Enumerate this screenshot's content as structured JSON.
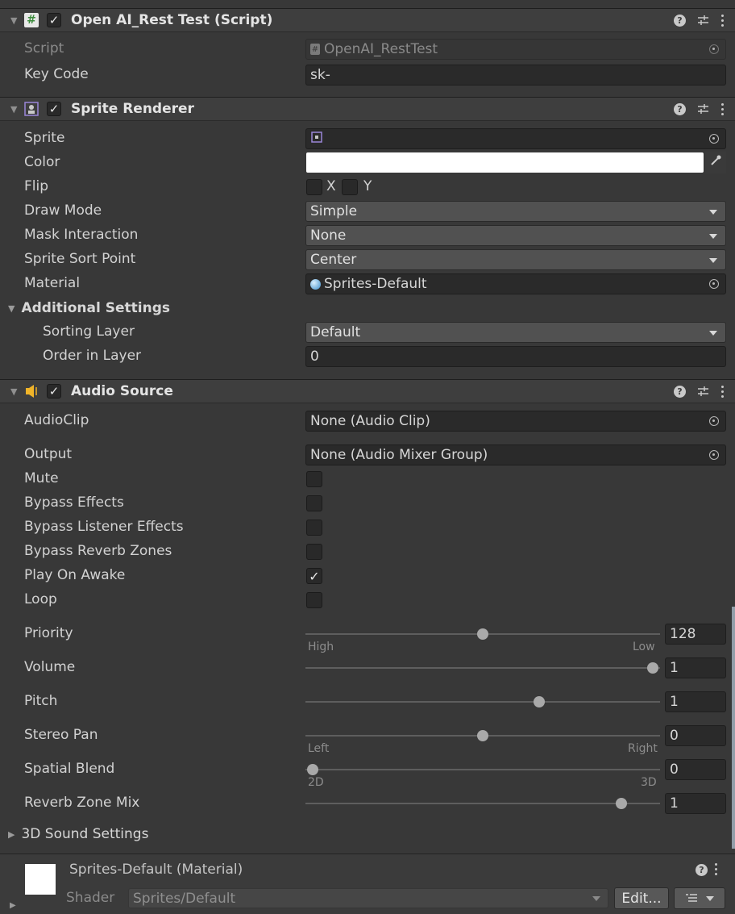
{
  "script_component": {
    "title": "Open AI_Rest Test (Script)",
    "enabled": true,
    "script_label": "Script",
    "script_value": "OpenAI_RestTest",
    "key_code_label": "Key Code",
    "key_code_value": "sk-"
  },
  "sprite_renderer": {
    "title": "Sprite Renderer",
    "enabled": true,
    "sprite_label": "Sprite",
    "color_label": "Color",
    "color_value": "#ffffff",
    "flip_label": "Flip",
    "flip_x_label": "X",
    "flip_y_label": "Y",
    "flip_x": false,
    "flip_y": false,
    "draw_mode_label": "Draw Mode",
    "draw_mode_value": "Simple",
    "mask_interaction_label": "Mask Interaction",
    "mask_interaction_value": "None",
    "sprite_sort_point_label": "Sprite Sort Point",
    "sprite_sort_point_value": "Center",
    "material_label": "Material",
    "material_value": "Sprites-Default",
    "additional_settings_label": "Additional Settings",
    "sorting_layer_label": "Sorting Layer",
    "sorting_layer_value": "Default",
    "order_in_layer_label": "Order in Layer",
    "order_in_layer_value": "0"
  },
  "audio_source": {
    "title": "Audio Source",
    "enabled": true,
    "audioclip_label": "AudioClip",
    "audioclip_value": "None (Audio Clip)",
    "output_label": "Output",
    "output_value": "None (Audio Mixer Group)",
    "mute_label": "Mute",
    "bypass_effects_label": "Bypass Effects",
    "bypass_listener_effects_label": "Bypass Listener Effects",
    "bypass_reverb_zones_label": "Bypass Reverb Zones",
    "play_on_awake_label": "Play On Awake",
    "loop_label": "Loop",
    "mute": false,
    "bypass_effects": false,
    "bypass_listener_effects": false,
    "bypass_reverb_zones": false,
    "play_on_awake": true,
    "loop": false,
    "priority_label": "Priority",
    "priority_value": "128",
    "priority_min_label": "High",
    "priority_max_label": "Low",
    "volume_label": "Volume",
    "volume_value": "1",
    "pitch_label": "Pitch",
    "pitch_value": "1",
    "stereo_pan_label": "Stereo Pan",
    "stereo_pan_value": "0",
    "stereo_pan_min_label": "Left",
    "stereo_pan_max_label": "Right",
    "spatial_blend_label": "Spatial Blend",
    "spatial_blend_value": "0",
    "spatial_blend_min_label": "2D",
    "spatial_blend_max_label": "3D",
    "reverb_zone_mix_label": "Reverb Zone Mix",
    "reverb_zone_mix_value": "1",
    "sound_3d_settings_label": "3D Sound Settings"
  },
  "material": {
    "title": "Sprites-Default (Material)",
    "shader_label": "Shader",
    "shader_value": "Sprites/Default",
    "edit_label": "Edit..."
  },
  "colors": {
    "background": "#383838",
    "header": "#3e3e3e",
    "field": "#2a2a2a",
    "dropdown": "#515151",
    "audio_icon": "#f0b429",
    "script_icon": "#4caf50"
  }
}
